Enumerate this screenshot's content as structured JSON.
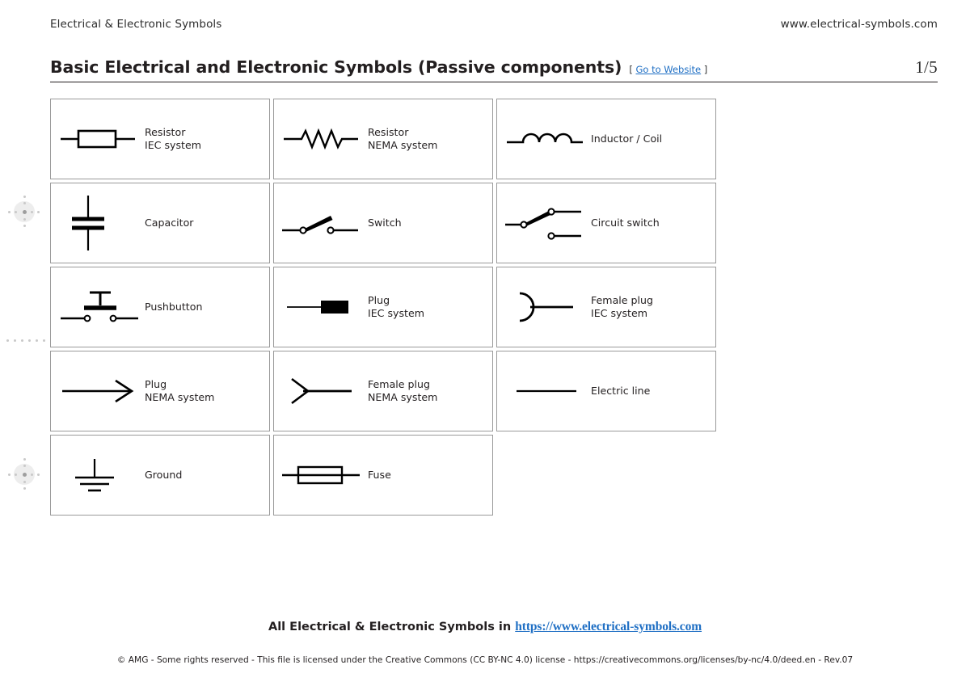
{
  "header": {
    "left_text": "Electrical & Electronic Symbols",
    "right_text": "www.electrical-symbols.com"
  },
  "title_bar": {
    "title": "Basic Electrical and Electronic Symbols (Passive components)",
    "link_open_bracket": "[",
    "link_text": "Go to Website",
    "link_close_bracket": "]",
    "page_number": "1/5"
  },
  "colors": {
    "link": "#1f6fc4",
    "text": "#231f20",
    "card_border": "#9a9a9a",
    "symbol_stroke": "#000000",
    "registration_mark": "#c9c9c9"
  },
  "symbols": [
    {
      "icon": "resistor-iec-icon",
      "label": "Resistor\nIEC system",
      "label_align": "left"
    },
    {
      "icon": "resistor-nema-icon",
      "label": "Resistor\nNEMA system",
      "label_align": "left"
    },
    {
      "icon": "inductor-coil-icon",
      "label": "Inductor / Coil",
      "label_align": "left"
    },
    {
      "icon": "capacitor-icon",
      "label": "Capacitor",
      "label_align": "left"
    },
    {
      "icon": "switch-icon",
      "label": "Switch",
      "label_align": "left"
    },
    {
      "icon": "circuit-switch-icon",
      "label": "Circuit switch",
      "label_align": "left"
    },
    {
      "icon": "pushbutton-icon",
      "label": "Pushbutton",
      "label_align": "left"
    },
    {
      "icon": "plug-iec-icon",
      "label": "Plug\nIEC system",
      "label_align": "left"
    },
    {
      "icon": "female-plug-iec-icon",
      "label": "Female plug\nIEC system",
      "label_align": "left"
    },
    {
      "icon": "plug-nema-icon",
      "label": "Plug\nNEMA system",
      "label_align": "left"
    },
    {
      "icon": "female-plug-nema-icon",
      "label": "Female plug\nNEMA system",
      "label_align": "left"
    },
    {
      "icon": "electric-line-icon",
      "label": "Electric line",
      "label_align": "left"
    },
    {
      "icon": "ground-icon",
      "label": "Ground",
      "label_align": "left"
    },
    {
      "icon": "fuse-icon",
      "label": "Fuse",
      "label_align": "left"
    }
  ],
  "footer": {
    "main_text": "All Electrical & Electronic Symbols in ",
    "main_link": "https://www.electrical-symbols.com",
    "legal": "© AMG - Some rights reserved - This file is licensed under the Creative Commons (CC BY-NC 4.0) license - https://creativecommons.org/licenses/by-nc/4.0/deed.en - Rev.07"
  }
}
